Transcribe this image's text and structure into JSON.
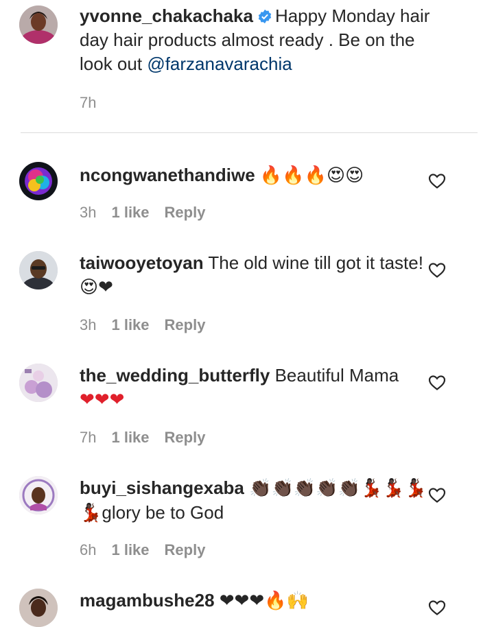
{
  "post": {
    "username": "yvonne_chakachaka",
    "text": "Happy Monday hair day hair products almost ready . Be on the look out",
    "mention": "@farzanavarachia",
    "time": "7h"
  },
  "comments": [
    {
      "username": "ncongwanethandiwe",
      "text": "",
      "emoji": "🔥🔥🔥😍😍",
      "time": "3h",
      "likes": "1 like",
      "reply": "Reply"
    },
    {
      "username": "taiwooyetoyan",
      "text": "The old wine till got it taste!",
      "emoji": "😍❤",
      "time": "3h",
      "likes": "1 like",
      "reply": "Reply"
    },
    {
      "username": "the_wedding_butterfly",
      "text": "Beautiful Mama",
      "emoji": "❤❤❤",
      "time": "7h",
      "likes": "1 like",
      "reply": "Reply"
    },
    {
      "username": "buyi_sishangexaba",
      "text": "glory be to God",
      "emoji_before": "👏🏿👏🏿👏🏿👏🏿👏🏿💃🏿💃🏿💃🏿",
      "emoji_line2": "💃🏿",
      "time": "6h",
      "likes": "1 like",
      "reply": "Reply"
    },
    {
      "username": "magambushe28",
      "text": "",
      "emoji": "❤❤❤🔥🙌",
      "time": "",
      "likes": "",
      "reply": ""
    }
  ],
  "icons": {
    "verified": "verified-badge-icon",
    "like": "heart-outline-icon"
  },
  "colors": {
    "text": "#262626",
    "secondary": "#8e8e8e",
    "mention": "#00376b",
    "verified": "#3897f0",
    "divider": "#dbdbdb"
  }
}
